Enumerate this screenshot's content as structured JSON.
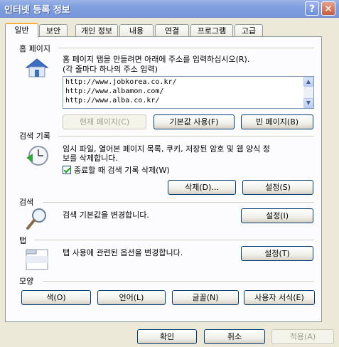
{
  "window": {
    "title": "인터넷 등록 정보",
    "help_label": "?",
    "close_label": "✕"
  },
  "tabs": [
    "일반",
    "보안",
    "개인 정보",
    "내용",
    "연결",
    "프로그램",
    "고급"
  ],
  "homepage": {
    "title": "홈 페이지",
    "instructions_1": "홈 페이지 탭을 만들려면 아래에 주소를 입력하십시오(R).",
    "instructions_2": "(각 줄마다 하나의 주소 입력)",
    "urls": [
      "http://www.jobkorea.co.kr/",
      "http://www.albamon.com/",
      "http://www.alba.co.kr/"
    ],
    "current_button": "현재 페이지(C)",
    "default_button": "기본값 사용(F)",
    "blank_button": "빈 페이지(B)",
    "icon": "house-icon"
  },
  "history": {
    "title": "검색 기록",
    "description_1": "임시 파일, 열어본 페이지 목록, 쿠키, 저장된 암호 및 웹 양식 정",
    "description_2": "보를 삭제합니다.",
    "checkbox_label": "종료할 때 검색 기록 삭제(W)",
    "checkbox_checked": true,
    "delete_button": "삭제(D)...",
    "settings_button": "설정(S)",
    "icon": "history-clock-icon"
  },
  "search": {
    "title": "검색",
    "description": "검색 기본값을 변경합니다.",
    "settings_button": "설정(I)",
    "icon": "magnifier-icon"
  },
  "tabs_section": {
    "title": "탭",
    "description": "탭 사용에 관련된 옵션을 변경합니다.",
    "settings_button": "설정(T)",
    "icon": "tabs-window-icon"
  },
  "appearance": {
    "title": "모양",
    "color_button": "색(O)",
    "language_button": "언어(L)",
    "font_button": "글꼴(N)",
    "accessibility_button": "사용자 서식(E)"
  },
  "footer": {
    "ok_button": "확인",
    "cancel_button": "취소",
    "apply_button": "적용(A)"
  }
}
